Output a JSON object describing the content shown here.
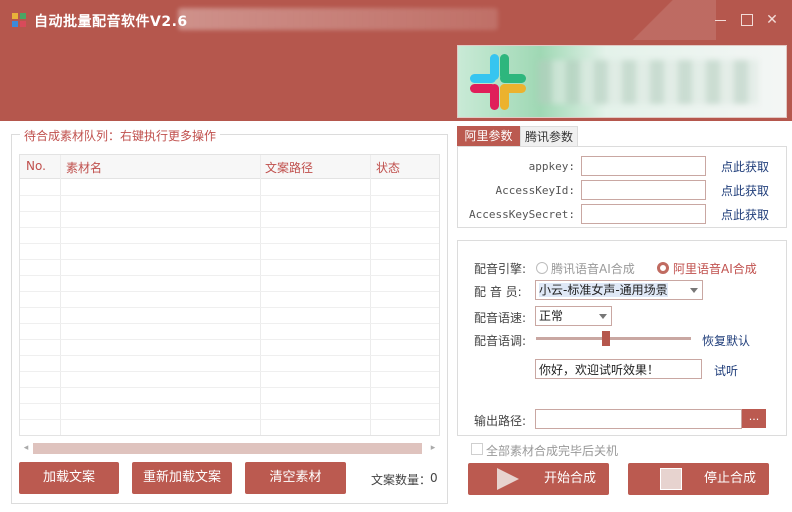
{
  "window": {
    "title": "自动批量配音软件V2.6",
    "controls": {
      "minimize": "–",
      "maximize": "□",
      "close": "✕"
    }
  },
  "left": {
    "group_title": "待合成素材队列：右键执行更多操作",
    "columns": [
      "No.",
      "素材名",
      "文案路径",
      "状态"
    ],
    "rows": [],
    "buttons": {
      "load": "加载文案",
      "reload": "重新加载文案",
      "clear": "清空素材"
    },
    "count_label": "文案数量：",
    "count_value": "0"
  },
  "tabs": [
    {
      "label": "阿里参数",
      "active": true
    },
    {
      "label": "腾讯参数",
      "active": false
    }
  ],
  "params": {
    "appkey": {
      "label": "appkey:",
      "value": "",
      "link": "点此获取"
    },
    "access_key_id": {
      "label": "AccessKeyId:",
      "value": "",
      "link": "点此获取"
    },
    "access_key_secret": {
      "label": "AccessKeySecret:",
      "value": "",
      "link": "点此获取"
    }
  },
  "settings": {
    "engine_label": "配音引擎:",
    "engine_options": [
      {
        "label": "腾讯语音AI合成",
        "selected": false
      },
      {
        "label": "阿里语音AI合成",
        "selected": true
      }
    ],
    "voice_label": "配 音 员:",
    "voice_value": "小云-标准女声-通用场景",
    "speed_label": "配音语速:",
    "speed_value": "正常",
    "pitch_label": "配音语调:",
    "pitch_level": 0.45,
    "reset_link": "恢复默认",
    "preview_text": "你好，欢迎试听效果！",
    "preview_link": "试听",
    "output_label": "输出路径:",
    "output_value": "",
    "browse_label": "...",
    "shutdown_label": "全部素材合成完毕后关机",
    "shutdown_checked": false
  },
  "actions": {
    "start": "开始合成",
    "stop": "停止合成"
  },
  "colors": {
    "header": "#b5574d",
    "button": "#bb5a50",
    "accent_text": "#c0504d",
    "link": "#1f3d7a"
  }
}
